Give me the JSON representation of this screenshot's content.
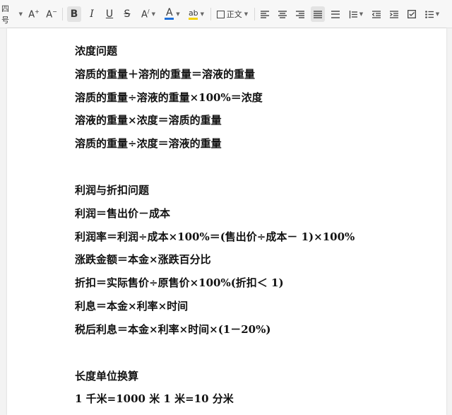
{
  "toolbar": {
    "font_size": "四号",
    "style": "正文",
    "bold": "B",
    "italic": "I",
    "underline": "U",
    "strike": "S",
    "increase_font": "A⁺",
    "decrease_font": "A⁻",
    "font_color": "A",
    "highlight": "ab",
    "accent_color": "#1e6fd9",
    "highlight_color": "#f5d200"
  },
  "doc": {
    "sections": [
      {
        "heading": "浓度问题",
        "lines": [
          "溶质的重量＋溶剂的重量＝溶液的重量",
          "溶质的重量÷溶液的重量×100%＝浓度",
          "溶液的重量×浓度＝溶质的重量",
          "溶质的重量÷浓度＝溶液的重量"
        ]
      },
      {
        "heading": "利润与折扣问题",
        "lines": [
          "利润＝售出价－成本",
          "利润率＝利润÷成本×100%＝(售出价÷成本－ 1)×100%",
          "涨跌金额＝本金×涨跌百分比",
          "折扣＝实际售价÷原售价×100%(折扣＜ 1)",
          "利息＝本金×利率×时间",
          "税后利息＝本金×利率×时间×(1－20%)"
        ]
      },
      {
        "heading": "长度单位换算",
        "lines": [
          "1 千米=1000 米 1 米=10 分米"
        ]
      }
    ]
  }
}
